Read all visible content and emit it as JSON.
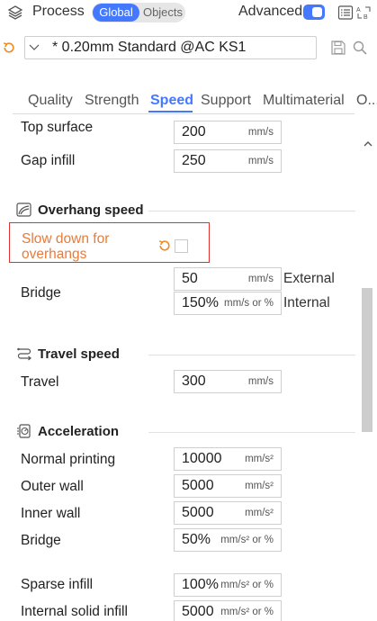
{
  "header": {
    "title": "Process",
    "mode_global": "Global",
    "mode_objects": "Objects",
    "advanced_label": "Advanced",
    "advanced_enabled": true
  },
  "preset": {
    "name": "* 0.20mm Standard @AC KS1"
  },
  "tabs": [
    {
      "label": "Quality",
      "active": false
    },
    {
      "label": "Strength",
      "active": false
    },
    {
      "label": "Speed",
      "active": true
    },
    {
      "label": "Support",
      "active": false
    },
    {
      "label": "Multimaterial",
      "active": false
    },
    {
      "label": "O...",
      "active": false
    }
  ],
  "cut_row": {
    "label": "Top surface",
    "value": "200",
    "unit": "mm/s"
  },
  "gap_infill": {
    "label": "Gap infill",
    "value": "250",
    "unit": "mm/s"
  },
  "overhang": {
    "title": "Overhang speed",
    "slow_down_line1": "Slow down for",
    "slow_down_line2": "overhangs",
    "slow_down_checked": false,
    "bridge_label": "Bridge",
    "bridge_external": {
      "value": "50",
      "unit": "mm/s",
      "side": "External"
    },
    "bridge_internal": {
      "value": "150%",
      "unit": "mm/s or %",
      "side": "Internal"
    }
  },
  "travel": {
    "title": "Travel speed",
    "travel_label": "Travel",
    "travel_value": "300",
    "travel_unit": "mm/s"
  },
  "acceleration": {
    "title": "Acceleration",
    "rows": [
      {
        "label": "Normal printing",
        "value": "10000",
        "unit": "mm/s²"
      },
      {
        "label": "Outer wall",
        "value": "5000",
        "unit": "mm/s²"
      },
      {
        "label": "Inner wall",
        "value": "5000",
        "unit": "mm/s²"
      },
      {
        "label": "Bridge",
        "value": "50%",
        "unit": "mm/s² or %"
      },
      {
        "label": "Sparse infill",
        "value": "100%",
        "unit": "mm/s² or %"
      },
      {
        "label": "Internal solid infill",
        "value": "5000",
        "unit": "mm/s² or %"
      }
    ]
  },
  "colors": {
    "accent": "#4479ff",
    "warning_border": "#e0302f",
    "warning_text": "#e87b3a",
    "reset_orange": "#f08a24"
  },
  "icons": {
    "process": "layers-icon",
    "list": "list-view-icon",
    "compare": "compare-icon",
    "reset": "reset-icon",
    "save": "save-icon",
    "search": "search-icon",
    "overhang": "overhang-icon",
    "travel": "travel-icon",
    "acceleration": "acceleration-icon"
  }
}
